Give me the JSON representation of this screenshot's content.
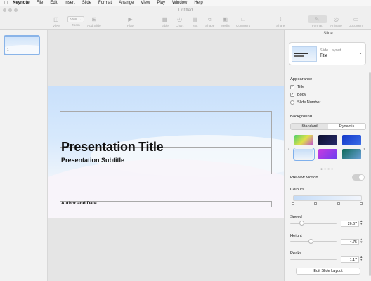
{
  "menubar": {
    "apple": "",
    "items": [
      "Keynote",
      "File",
      "Edit",
      "Insert",
      "Slide",
      "Format",
      "Arrange",
      "View",
      "Play",
      "Window",
      "Help"
    ]
  },
  "window": {
    "title": "Untitled"
  },
  "toolbar": {
    "view": "View",
    "zoom_value": "99%",
    "zoom": "Zoom",
    "add_slide": "Add Slide",
    "play": "Play",
    "table": "Table",
    "chart": "Chart",
    "text": "Text",
    "shape": "Shape",
    "media": "Media",
    "comment": "Comment",
    "share": "Share",
    "format": "Format",
    "animate": "Animate",
    "document": "Document"
  },
  "navigator": {
    "slide_number": "1"
  },
  "slide": {
    "title": "Presentation Title",
    "subtitle": "Presentation Subtitle",
    "author": "Author and Date"
  },
  "inspector": {
    "tab": "Slide",
    "layout": {
      "label": "Slide Layout",
      "value": "Title"
    },
    "appearance": {
      "heading": "Appearance",
      "title": {
        "label": "Title",
        "checked": true
      },
      "body": {
        "label": "Body",
        "checked": true
      },
      "slide_number": {
        "label": "Slide Number",
        "checked": false
      }
    },
    "background": {
      "heading": "Background",
      "segments": [
        "Standard",
        "Dynamic"
      ],
      "selected_segment": "Dynamic",
      "swatches": [
        {
          "name": "rainbow",
          "colors": [
            "#4fd06a",
            "#e0e04a",
            "#c04ad8"
          ]
        },
        {
          "name": "midnight",
          "colors": [
            "#0e1030",
            "#24286a"
          ]
        },
        {
          "name": "blue",
          "colors": [
            "#1438c8",
            "#3a6ee8"
          ]
        },
        {
          "name": "sky",
          "colors": [
            "#c6ddf7",
            "#eef4fb"
          ],
          "selected": true
        },
        {
          "name": "purple",
          "colors": [
            "#c83ae0",
            "#6a3cf0"
          ]
        },
        {
          "name": "teal",
          "colors": [
            "#0e6a5a",
            "#6aa0d8"
          ]
        }
      ],
      "pages": 4,
      "current_page": 1
    },
    "preview_motion": {
      "label": "Preview Motion",
      "on": true
    },
    "colours": {
      "heading": "Colours"
    },
    "speed": {
      "label": "Speed",
      "value": "26.67",
      "level": 0.25
    },
    "height": {
      "label": "Height",
      "value": "4.75",
      "level": 0.45
    },
    "peaks": {
      "label": "Peaks",
      "value": "1.17"
    },
    "edit_layout_button": "Edit Slide Layout"
  }
}
